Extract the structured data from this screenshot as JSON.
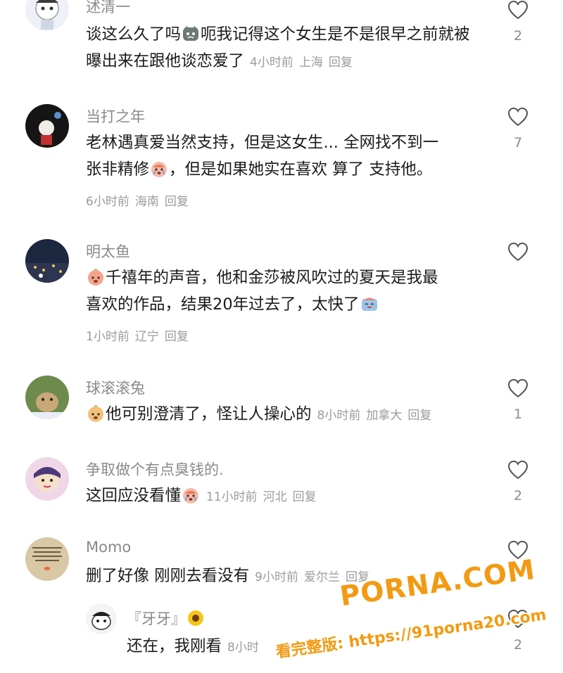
{
  "comments": [
    {
      "username": "述清一",
      "text_parts": [
        "谈这么久了吗",
        "呃我记得这个女生是不是很早之前就被曝出来在跟他谈恋爱了"
      ],
      "time": "4小时前",
      "location": "上海",
      "reply": "回复",
      "likes": "2",
      "emoji": "cat-face-emoji"
    },
    {
      "username": "当打之年",
      "line1": "老林遇真爱当然支持，但是这女生... 全网找不到一",
      "line2_a": "张非精修",
      "line2_b": "，但是如果她实在喜欢 算了 支持他。",
      "time": "6小时前",
      "location": "海南",
      "reply": "回复",
      "likes": "7",
      "emoji": "crying-face-emoji"
    },
    {
      "username": "明太鱼",
      "line1": "千禧年的声音，他和金莎被风吹过的夏天是我最",
      "line2": "喜欢的作品，结果20年过去了，太快了",
      "time": "1小时前",
      "location": "辽宁",
      "reply": "回复",
      "likes": "",
      "emoji": "peach-face-emoji"
    },
    {
      "username": "球滚滚兔",
      "text": "他可别澄清了，怪让人操心的",
      "time": "8小时前",
      "location": "加拿大",
      "reply": "回复",
      "likes": "1",
      "emoji": "peach-face-emoji"
    },
    {
      "username": "争取做个有点臭钱的.",
      "text": "这回应没看懂",
      "time": "11小时前",
      "location": "河北",
      "reply": "回复",
      "likes": "2",
      "emoji": "crying-face-emoji"
    },
    {
      "username": "Momo",
      "text": "删了好像 刚刚去看没有",
      "time": "9小时前",
      "location": "爱尔兰",
      "reply": "回复",
      "likes": ""
    }
  ],
  "reply": {
    "username": "『牙牙』",
    "text": "还在，我刚看",
    "time": "8小时",
    "likes": "2"
  },
  "watermark": {
    "brand": "PORNA.COM",
    "url_line": "看完整版: https://91porna20.com"
  },
  "colors": {
    "name": "#8a8a8a",
    "text": "#1a1a1a",
    "meta": "#9b9b9b",
    "watermark": "#f39a12"
  }
}
